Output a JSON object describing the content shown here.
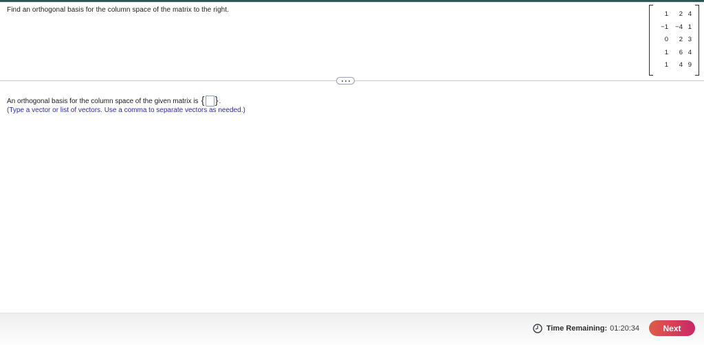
{
  "theme": {
    "top_bar_color": "#2f5e5e",
    "hint_blue": "#2b2ba3",
    "input_border_blue": "#7fa3d1",
    "next_gradient_start": "#df5c47",
    "next_gradient_end": "#ca2767",
    "divider_gray": "#cccccc"
  },
  "question": {
    "text": "Find an orthogonal basis for the column space of the matrix to the right."
  },
  "matrix": {
    "rows": [
      [
        "1",
        "2",
        "4"
      ],
      [
        "−1",
        "−4",
        "1"
      ],
      [
        "0",
        "2",
        "3"
      ],
      [
        "1",
        "6",
        "4"
      ],
      [
        "1",
        "4",
        "9"
      ]
    ]
  },
  "answer": {
    "prefix": "An orthogonal basis for the column space of the given matrix is",
    "open_brace": "{",
    "close_brace": "}",
    "suffix": ".",
    "input_value": "",
    "hint": "(Type a vector or list of vectors. Use a comma to separate vectors as needed.)"
  },
  "footer": {
    "time_label": "Time Remaining:",
    "time_value": "01:20:34",
    "next_label": "Next"
  }
}
